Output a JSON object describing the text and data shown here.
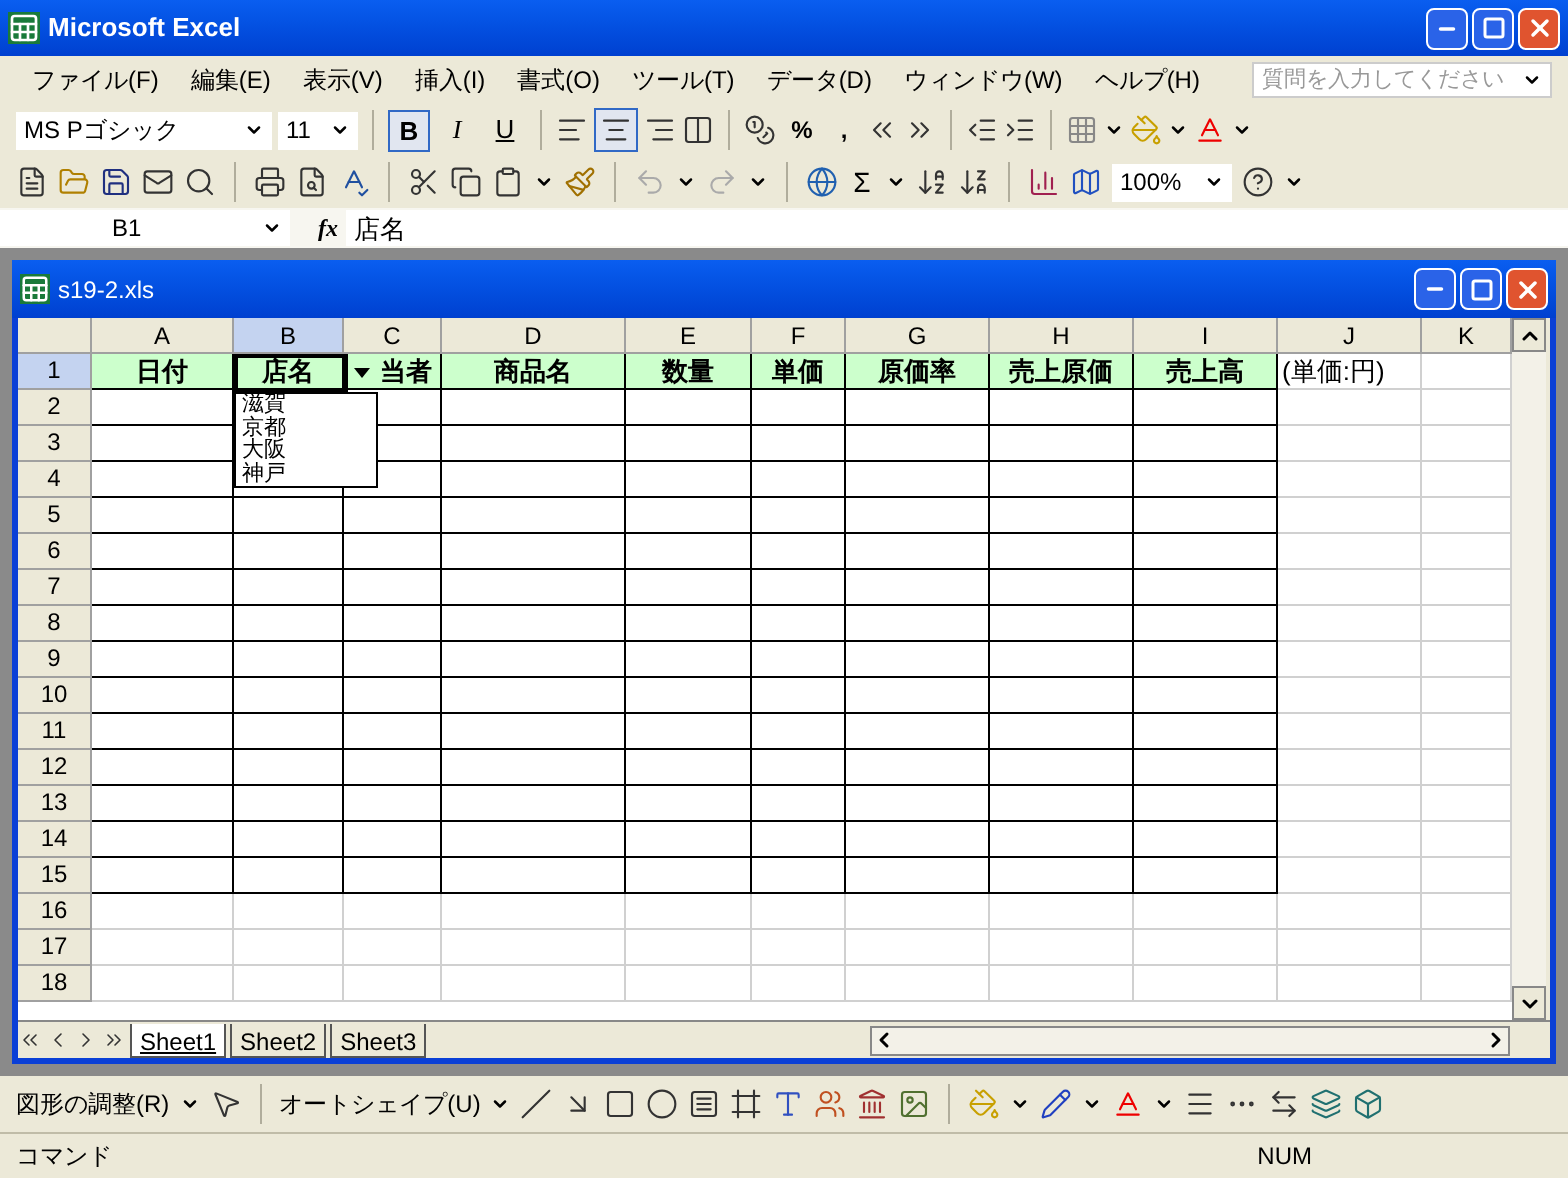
{
  "window": {
    "title": "Microsoft Excel"
  },
  "menu": [
    "ファイル(F)",
    "編集(E)",
    "表示(V)",
    "挿入(I)",
    "書式(O)",
    "ツール(T)",
    "データ(D)",
    "ウィンドウ(W)",
    "ヘルプ(H)"
  ],
  "help_search": {
    "placeholder": "質問を入力してください"
  },
  "formatting": {
    "font": "MS Pゴシック",
    "size": "11",
    "buttons": [
      {
        "label": "B",
        "kind": "bold",
        "selected": true
      },
      {
        "label": "I",
        "kind": "italic",
        "selected": false
      },
      {
        "label": "U",
        "kind": "underline",
        "selected": false
      }
    ],
    "align_center_selected": true,
    "percent": "%",
    "comma": ","
  },
  "standard": {
    "sum": "Σ",
    "zoom": "100%"
  },
  "formula_bar": {
    "name_box": "B1",
    "function_label": "fx",
    "formula": "店名"
  },
  "workbook": {
    "title": "s19-2.xls",
    "columns": [
      {
        "label": "A",
        "selected": false
      },
      {
        "label": "B",
        "selected": true
      },
      {
        "label": "C",
        "selected": false
      },
      {
        "label": "D",
        "selected": false
      },
      {
        "label": "E",
        "selected": false
      },
      {
        "label": "F",
        "selected": false
      },
      {
        "label": "G",
        "selected": false
      },
      {
        "label": "H",
        "selected": false
      },
      {
        "label": "I",
        "selected": false
      },
      {
        "label": "J",
        "selected": false
      },
      {
        "label": "K",
        "selected": false
      }
    ],
    "rows": [
      {
        "header": "1",
        "selected": true,
        "cells": [
          "日付",
          "店名",
          "当者",
          "商品名",
          "数量",
          "単価",
          "原価率",
          "売上原価",
          "売上高",
          "(単価:円)"
        ]
      },
      {
        "header": "2",
        "selected": false
      },
      {
        "header": "3",
        "selected": false
      },
      {
        "header": "4",
        "selected": false
      },
      {
        "header": "5",
        "selected": false
      },
      {
        "header": "6",
        "selected": false
      },
      {
        "header": "7",
        "selected": false
      },
      {
        "header": "8",
        "selected": false
      },
      {
        "header": "9",
        "selected": false
      },
      {
        "header": "10",
        "selected": false
      },
      {
        "header": "11",
        "selected": false
      },
      {
        "header": "12",
        "selected": false
      },
      {
        "header": "13",
        "selected": false
      },
      {
        "header": "14",
        "selected": false
      },
      {
        "header": "15",
        "selected": false
      },
      {
        "header": "16",
        "selected": false
      },
      {
        "header": "17",
        "selected": false
      },
      {
        "header": "18",
        "selected": false
      }
    ],
    "dropdown": [
      "滋賀",
      "京都",
      "大阪",
      "神戸"
    ],
    "sheets": [
      {
        "label": "Sheet1",
        "selected": true
      },
      {
        "label": "Sheet2",
        "selected": false
      },
      {
        "label": "Sheet3",
        "selected": false
      }
    ]
  },
  "drawing_toolbar": {
    "adjust": "図形の調整(R)",
    "autoshape": "オートシェイプ(U)"
  },
  "status_bar": {
    "mode": "コマンド",
    "num": "NUM"
  }
}
